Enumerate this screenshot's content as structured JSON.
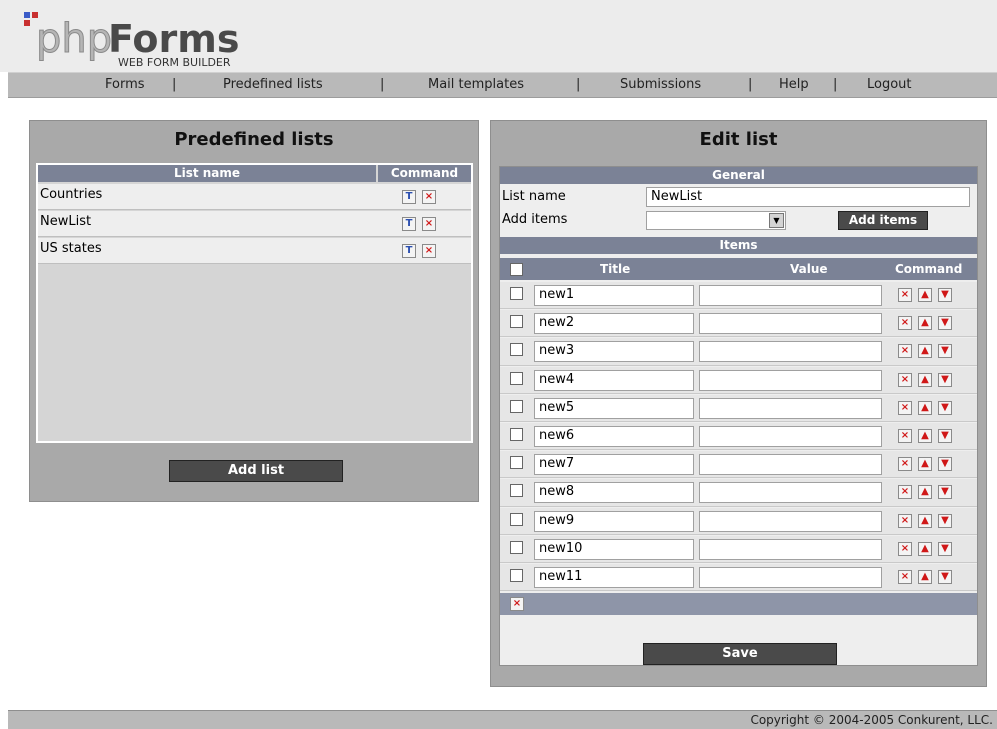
{
  "logo": {
    "text_php": "php",
    "text_forms": "Forms",
    "tagline": "WEB FORM BUILDER"
  },
  "nav": {
    "items": [
      "Forms",
      "Predefined lists",
      "Mail templates",
      "Submissions",
      "Help",
      "Logout"
    ],
    "separator": "|"
  },
  "left_panel": {
    "title": "Predefined lists",
    "col_name": "List name",
    "col_command": "Command",
    "rows": [
      "Countries",
      "NewList",
      "US states"
    ],
    "add_button": "Add list"
  },
  "right_panel": {
    "title": "Edit list",
    "general_header": "General",
    "list_name_label": "List name",
    "list_name_value": "NewList",
    "add_items_label": "Add items",
    "add_items_select_value": "",
    "add_items_button": "Add items",
    "items_header": "Items",
    "col_title": "Title",
    "col_value": "Value",
    "col_command": "Command",
    "items": [
      {
        "title": "new1",
        "value": ""
      },
      {
        "title": "new2",
        "value": ""
      },
      {
        "title": "new3",
        "value": ""
      },
      {
        "title": "new4",
        "value": ""
      },
      {
        "title": "new5",
        "value": ""
      },
      {
        "title": "new6",
        "value": ""
      },
      {
        "title": "new7",
        "value": ""
      },
      {
        "title": "new8",
        "value": ""
      },
      {
        "title": "new9",
        "value": ""
      },
      {
        "title": "new10",
        "value": ""
      },
      {
        "title": "new11",
        "value": ""
      }
    ],
    "save_button": "Save"
  },
  "footer": {
    "copyright": "Copyright © 2004-2005 Conkurent, LLC."
  },
  "colors": {
    "table_header": "#7b8296",
    "panel": "#a9a9a9",
    "button": "#4a4a4a",
    "delete_icon": "#d01818",
    "edit_icon": "#2b4fb0"
  }
}
